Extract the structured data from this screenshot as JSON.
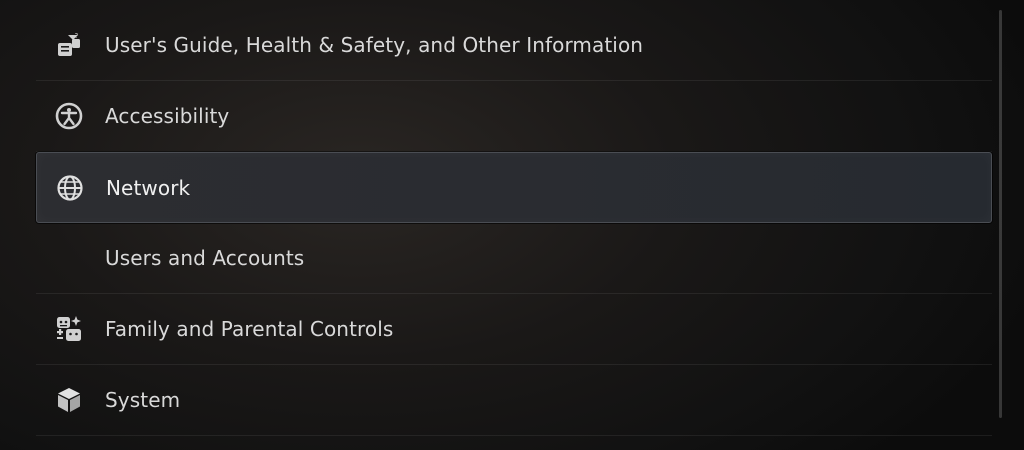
{
  "settings_menu": {
    "items": [
      {
        "label": "User's Guide, Health & Safety, and Other Information",
        "icon": "users-guide-icon",
        "selected": false
      },
      {
        "label": "Accessibility",
        "icon": "accessibility-icon",
        "selected": false
      },
      {
        "label": "Network",
        "icon": "globe-icon",
        "selected": true
      },
      {
        "label": "Users and Accounts",
        "icon": "",
        "selected": false
      },
      {
        "label": "Family and Parental Controls",
        "icon": "family-icon",
        "selected": false
      },
      {
        "label": "System",
        "icon": "cube-icon",
        "selected": false
      }
    ]
  },
  "colors": {
    "text": "#d9d9d9",
    "selected_text": "#f0f0f0",
    "selected_border": "#4a4d53"
  }
}
